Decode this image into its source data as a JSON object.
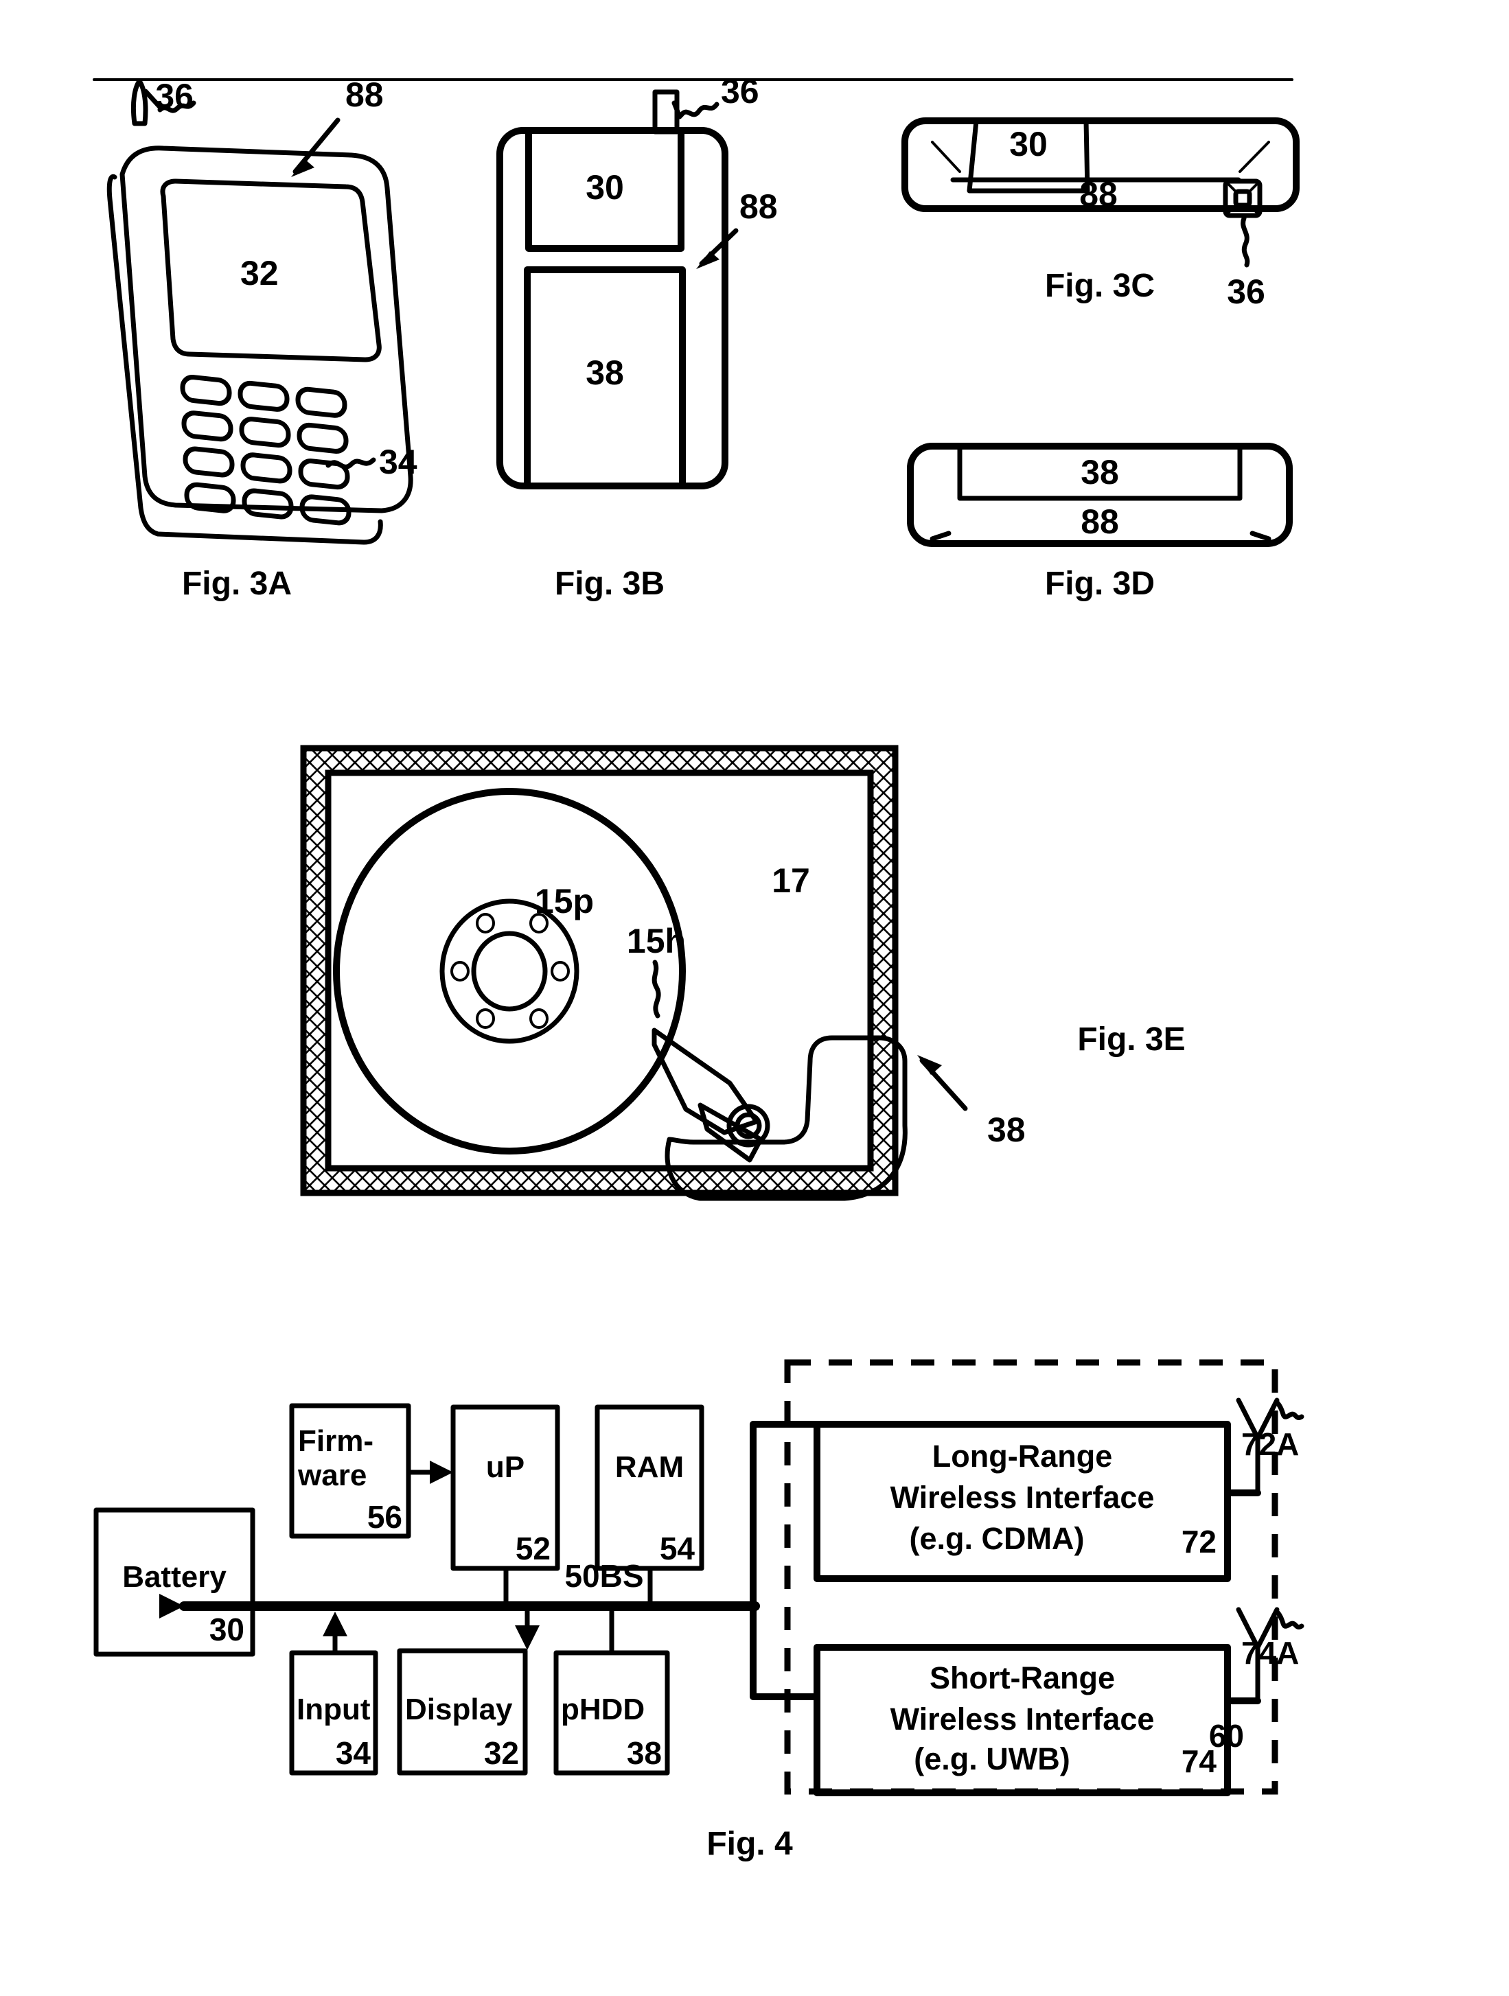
{
  "sheet": {
    "figures": [
      {
        "id": "fig-3a",
        "caption": "Fig. 3A",
        "description": "Perspective view of handheld wireless device with display and keypad",
        "callouts": [
          {
            "ref": "36",
            "meaning": "antenna"
          },
          {
            "ref": "88",
            "meaning": "handheld device body"
          },
          {
            "ref": "32",
            "meaning": "display"
          },
          {
            "ref": "34",
            "meaning": "input keypad"
          }
        ]
      },
      {
        "id": "fig-3b",
        "caption": "Fig. 3B",
        "description": "Rear view of handheld wireless device showing battery and perpendicular hard disk drive",
        "callouts": [
          {
            "ref": "36",
            "meaning": "antenna"
          },
          {
            "ref": "88",
            "meaning": "handheld device body"
          },
          {
            "ref": "30",
            "meaning": "battery"
          },
          {
            "ref": "38",
            "meaning": "pHDD"
          }
        ]
      },
      {
        "id": "fig-3c",
        "caption": "Fig. 3C",
        "description": "Top edge view of handheld wireless device",
        "callouts": [
          {
            "ref": "30",
            "meaning": "battery"
          },
          {
            "ref": "88",
            "meaning": "handheld device body"
          },
          {
            "ref": "36",
            "meaning": "antenna"
          }
        ]
      },
      {
        "id": "fig-3d",
        "caption": "Fig. 3D",
        "description": "Bottom edge view of handheld wireless device",
        "callouts": [
          {
            "ref": "38",
            "meaning": "pHDD"
          },
          {
            "ref": "88",
            "meaning": "handheld device body"
          }
        ]
      },
      {
        "id": "fig-3e",
        "caption": "Fig. 3E",
        "description": "Internal plan view of the hard disk drive showing disk platter, head and actuator inside hatched enclosure",
        "callouts": [
          {
            "ref": "15p",
            "meaning": "disk platter"
          },
          {
            "ref": "15h",
            "meaning": "read/write head"
          },
          {
            "ref": "17",
            "meaning": "drive base / enclosure interior"
          },
          {
            "ref": "38",
            "meaning": "pHDD"
          }
        ]
      },
      {
        "id": "fig-4",
        "caption": "Fig. 4",
        "description": "Block diagram of the handheld wireless device electronics"
      }
    ]
  },
  "fig3a": {
    "caption": "Fig. 3A",
    "ref_antenna": "36",
    "ref_body": "88",
    "ref_display": "32",
    "ref_keypad": "34"
  },
  "fig3b": {
    "caption": "Fig. 3B",
    "ref_antenna": "36",
    "ref_body": "88",
    "ref_battery": "30",
    "ref_phdd": "38"
  },
  "fig3c": {
    "caption": "Fig. 3C",
    "ref_battery": "30",
    "ref_body": "88",
    "ref_antenna": "36"
  },
  "fig3d": {
    "caption": "Fig. 3D",
    "ref_phdd": "38",
    "ref_body": "88"
  },
  "fig3e": {
    "caption": "Fig. 3E",
    "ref_platter": "15p",
    "ref_head": "15h",
    "ref_base": "17",
    "ref_phdd": "38"
  },
  "fig4": {
    "caption": "Fig. 4",
    "bus_label": "50BS",
    "enclosure_ref": "60",
    "blocks": [
      {
        "name": "battery",
        "label": "Battery",
        "num": "30"
      },
      {
        "name": "firmware",
        "label": "Firm-\nware",
        "label_line1": "Firm-",
        "label_line2": "ware",
        "num": "56"
      },
      {
        "name": "up",
        "label": "uP",
        "num": "52"
      },
      {
        "name": "ram",
        "label": "RAM",
        "num": "54"
      },
      {
        "name": "input",
        "label": "Input",
        "num": "34"
      },
      {
        "name": "display",
        "label": "Display",
        "num": "32"
      },
      {
        "name": "phdd",
        "label": "pHDD",
        "num": "38"
      }
    ],
    "long_range": {
      "line1": "Long-Range",
      "line2": "Wireless Interface",
      "line3": "(e.g. CDMA)",
      "num": "72",
      "antenna_ref": "72A"
    },
    "short_range": {
      "line1": "Short-Range",
      "line2": "Wireless Interface",
      "line3": "(e.g. UWB)",
      "num": "74",
      "antenna_ref": "74A"
    }
  },
  "colors": {
    "ink": "#000000",
    "paper": "#ffffff"
  }
}
